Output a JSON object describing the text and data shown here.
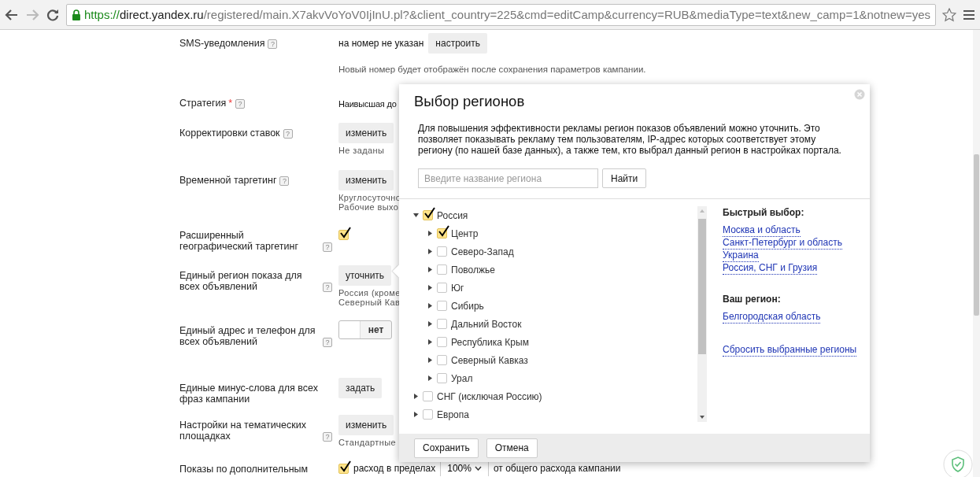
{
  "browser": {
    "address": {
      "scheme": "https://",
      "host": "direct.yandex.ru",
      "path": "/registered/main.X7akvVoYoV0IjInU.pl?&client_country=225&cmd=editCamp&currency=RUB&mediaType=text&new_camp=1&notnew=yes"
    }
  },
  "form": {
    "rows": [
      {
        "label": "SMS-уведомления",
        "help": "?",
        "kind": "text-button",
        "value": "на номер не указан",
        "button": "настроить",
        "note": "Новый номер будет отображён после сохранения параметров кампании."
      },
      {
        "label": "Стратегия",
        "required": "*",
        "help": "?",
        "kind": "text",
        "value": "Наивысшая до"
      },
      {
        "label": "Корректировки ставок",
        "help": "?",
        "kind": "button",
        "button": "изменить",
        "notes": [
          "Не заданы"
        ]
      },
      {
        "label": "Временной таргетинг",
        "help": "?",
        "kind": "button",
        "button": "изменить",
        "notes": [
          "Круглосуточно",
          "Рабочие выхо"
        ]
      },
      {
        "label": "Расширенный географический таргетинг",
        "help": "?",
        "kind": "checkbox",
        "checked": true
      },
      {
        "label": "Единый регион показа для всех объявлений",
        "help": "?",
        "kind": "button",
        "button": "уточнить",
        "notes": [
          "Россия (кроме",
          "Северный Кав"
        ]
      },
      {
        "label": "Единый адрес и телефон для всех объявлений",
        "help": "?",
        "kind": "toggle",
        "on": false,
        "text": "нет"
      },
      {
        "label": "Единые минус-слова для всех фраз кампании",
        "kind": "button",
        "button": "задать"
      },
      {
        "label": "Настройки на тематических площадках",
        "help": "?",
        "kind": "button",
        "button": "изменить",
        "notes": [
          "Стандартные"
        ]
      },
      {
        "label": "Показы по дополнительным",
        "kind": "budget",
        "checked": true,
        "text": "расход в пределах",
        "select": "100%",
        "suffix": "от общего расхода кампании"
      }
    ]
  },
  "dialog": {
    "title": "Выбор регионов",
    "description": "Для повышения эффективности рекламы регион показов объявлений можно уточнить. Это позволяет показывать рекламу тем пользователям, IP-адрес которых соответствует этому региону (по нашей базе данных), а также тем, кто выбрал данный регион в настройках портала.",
    "search": {
      "placeholder": "Введите название региона",
      "button": "Найти"
    },
    "tree": [
      {
        "label": "Россия",
        "checked": true,
        "expanded": true,
        "children": [
          {
            "label": "Центр",
            "checked": true,
            "expanded": false
          },
          {
            "label": "Северо-Запад",
            "checked": false,
            "expanded": false
          },
          {
            "label": "Поволжье",
            "checked": false,
            "expanded": false
          },
          {
            "label": "Юг",
            "checked": false,
            "expanded": false
          },
          {
            "label": "Сибирь",
            "checked": false,
            "expanded": false
          },
          {
            "label": "Дальний Восток",
            "checked": false,
            "expanded": false
          },
          {
            "label": "Республика Крым",
            "checked": false,
            "expanded": false
          },
          {
            "label": "Северный Кавказ",
            "checked": false,
            "expanded": false
          },
          {
            "label": "Урал",
            "checked": false,
            "expanded": false
          }
        ]
      },
      {
        "label": "СНГ (исключая Россию)",
        "checked": false,
        "expanded": false
      },
      {
        "label": "Европа",
        "checked": false,
        "expanded": false
      }
    ],
    "quick_title": "Быстрый выбор:",
    "quick_links": [
      "Москва и область",
      "Санкт-Петербург и область",
      "Украина",
      "Россия, СНГ и Грузия"
    ],
    "region_title": "Ваш регион:",
    "region_link": "Белгородская область",
    "reset_link": "Сбросить выбранные регионы",
    "buttons": [
      "Сохранить",
      "Отмена"
    ]
  }
}
